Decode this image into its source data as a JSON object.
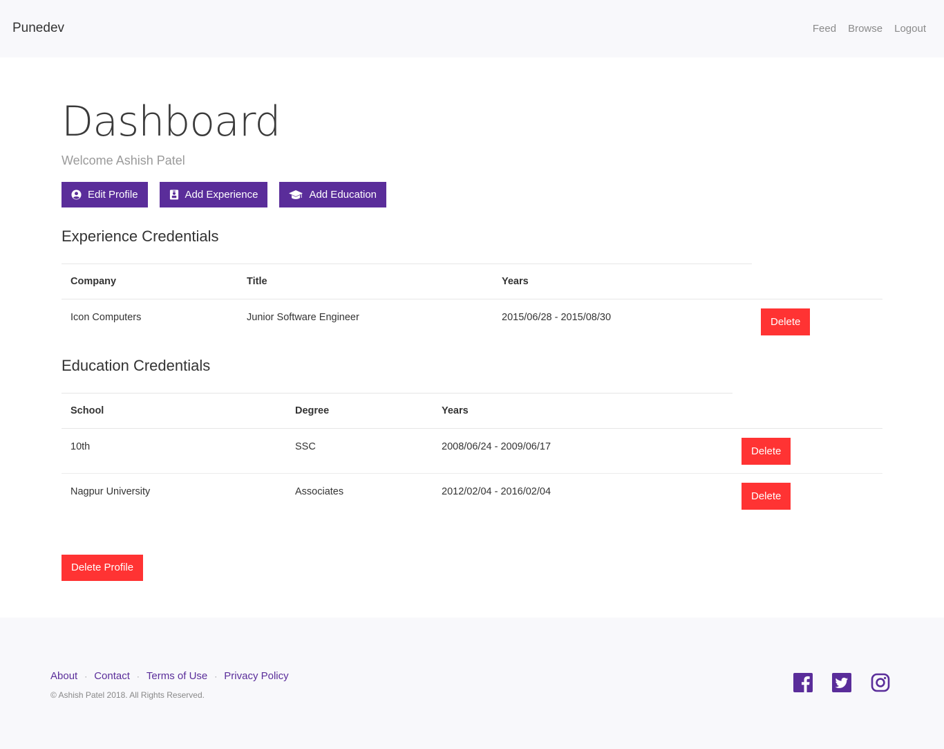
{
  "navbar": {
    "brand": "Punedev",
    "links": [
      "Feed",
      "Browse",
      "Logout"
    ]
  },
  "page": {
    "title": "Dashboard",
    "welcome": "Welcome Ashish Patel"
  },
  "actions": {
    "edit_profile": "Edit Profile",
    "add_experience": "Add Experience",
    "add_education": "Add Education"
  },
  "experience": {
    "heading": "Experience Credentials",
    "columns": [
      "Company",
      "Title",
      "Years"
    ],
    "rows": [
      {
        "company": "Icon Computers",
        "title": "Junior Software Engineer",
        "years": "2015/06/28 - 2015/08/30",
        "action": "Delete"
      }
    ]
  },
  "education": {
    "heading": "Education Credentials",
    "columns": [
      "School",
      "Degree",
      "Years"
    ],
    "rows": [
      {
        "school": "10th",
        "degree": "SSC",
        "years": "2008/06/24 - 2009/06/17",
        "action": "Delete"
      },
      {
        "school": "Nagpur University",
        "degree": "Associates",
        "years": "2012/02/04 - 2016/02/04",
        "action": "Delete"
      }
    ]
  },
  "delete_profile": "Delete Profile",
  "footer": {
    "links": [
      "About",
      "Contact",
      "Terms of Use",
      "Privacy Policy"
    ],
    "separator": "·",
    "copyright": "© Ashish Patel 2018. All Rights Reserved.",
    "social_icons": [
      "facebook-icon",
      "twitter-icon",
      "instagram-icon"
    ]
  },
  "colors": {
    "accent": "#5a2d9a",
    "danger": "#ff3333",
    "navbar_bg": "#f8f8fb"
  }
}
